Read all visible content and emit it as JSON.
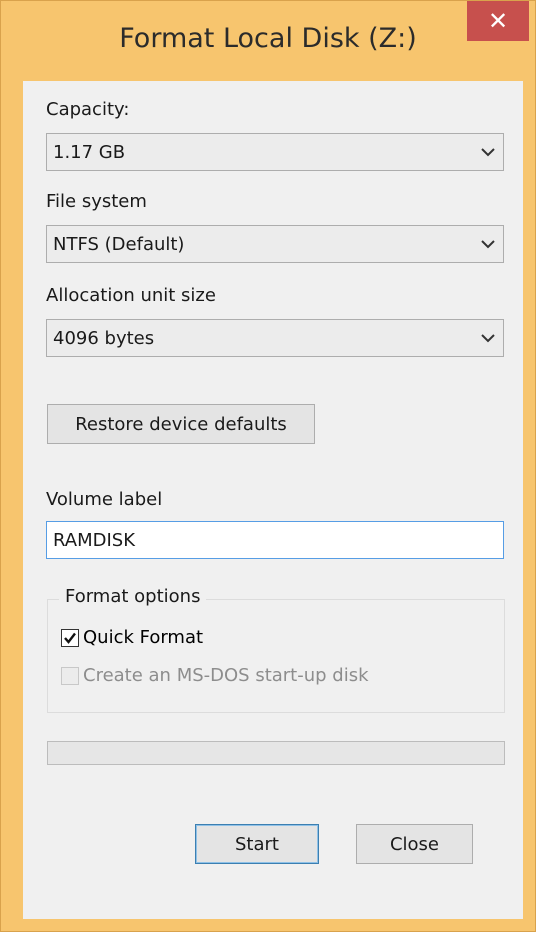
{
  "window": {
    "title": "Format Local Disk (Z:)",
    "close_glyph": "✕"
  },
  "capacity": {
    "label": "Capacity:",
    "value": "1.17 GB"
  },
  "file_system": {
    "label": "File system",
    "value": "NTFS (Default)"
  },
  "allocation": {
    "label": "Allocation unit size",
    "value": "4096 bytes"
  },
  "restore_button": "Restore device defaults",
  "volume_label": {
    "label": "Volume label",
    "value": "RAMDISK"
  },
  "format_options": {
    "title": "Format options",
    "quick_format": {
      "label": "Quick Format",
      "checked": true
    },
    "msdos_disk": {
      "label": "Create an MS-DOS start-up disk",
      "checked": false,
      "enabled": false
    }
  },
  "progress": {
    "fraction": 0
  },
  "buttons": {
    "start": "Start",
    "close": "Close"
  },
  "colors": {
    "title_bar": "#f7c56e",
    "close_button": "#c7504d",
    "dialog_body": "#f0f0f0",
    "focus_border": "#569de5"
  },
  "icons": {
    "dropdown": "chevron-down-icon",
    "check": "checkmark-icon"
  }
}
